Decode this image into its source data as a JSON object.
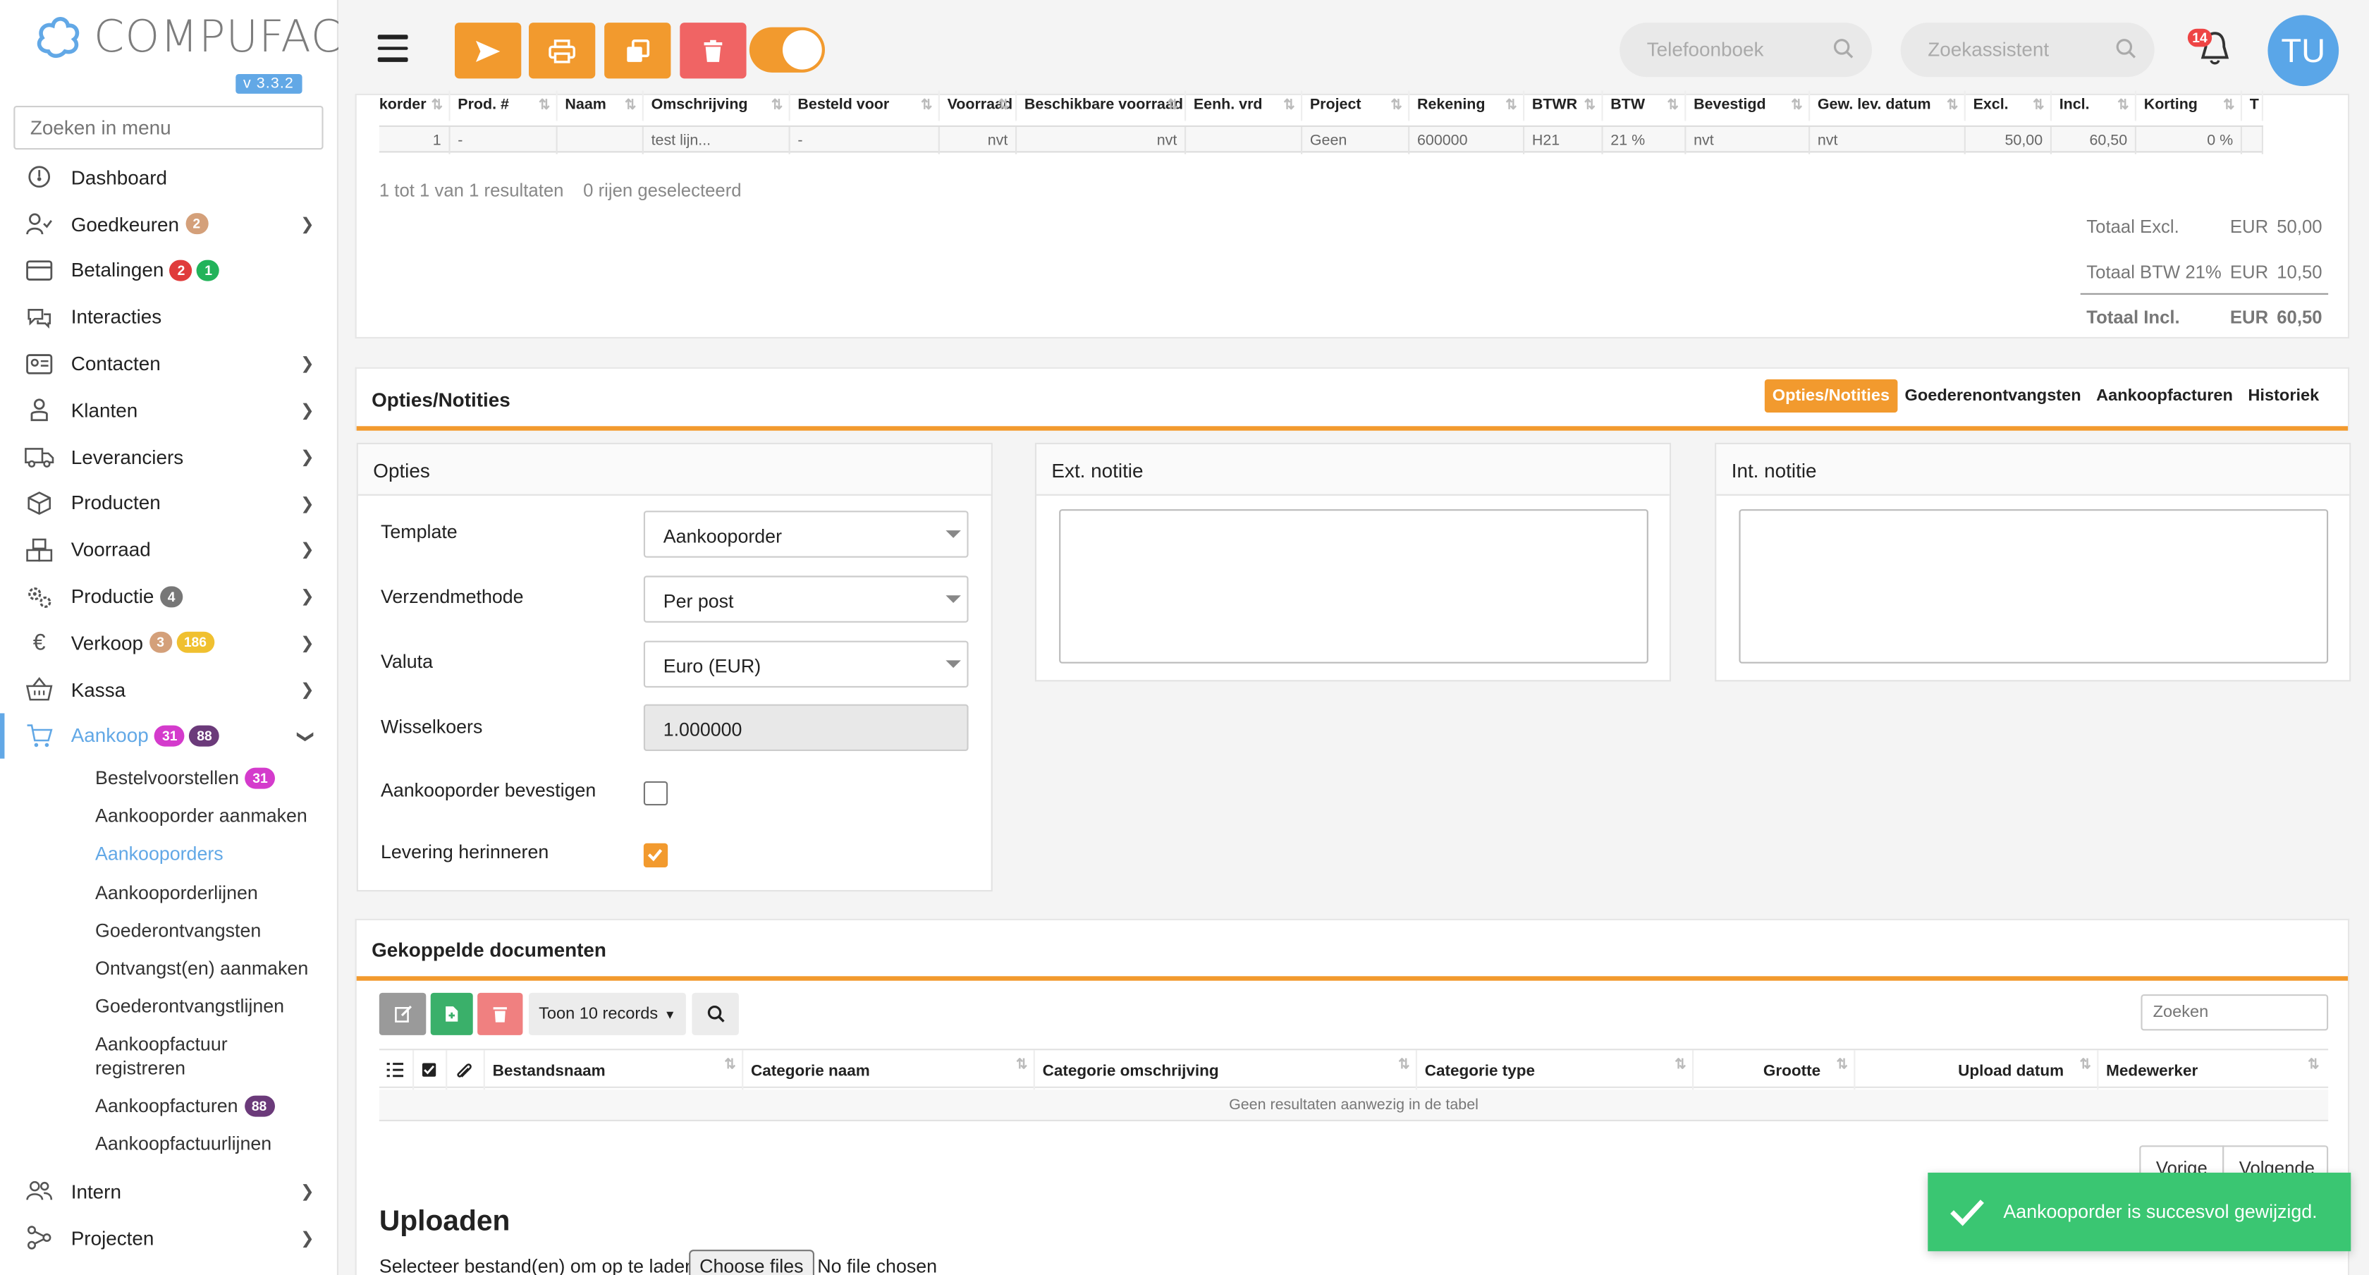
{
  "app": {
    "logo_text": "COMPUFACT",
    "version": "v 3.3.2"
  },
  "sidebar": {
    "search_placeholder": "Zoeken in menu",
    "items": [
      {
        "label": "Dashboard",
        "icon": "dashboard-icon"
      },
      {
        "label": "Goedkeuren",
        "icon": "user-check-icon",
        "badges": [
          "2"
        ]
      },
      {
        "label": "Betalingen",
        "icon": "credit-card-icon",
        "badges": [
          "2",
          "1"
        ]
      },
      {
        "label": "Interacties",
        "icon": "chat-icon"
      },
      {
        "label": "Contacten",
        "icon": "contact-card-icon"
      },
      {
        "label": "Klanten",
        "icon": "person-icon"
      },
      {
        "label": "Leveranciers",
        "icon": "truck-icon"
      },
      {
        "label": "Producten",
        "icon": "box-icon"
      },
      {
        "label": "Voorraad",
        "icon": "boxes-icon"
      },
      {
        "label": "Productie",
        "icon": "gears-icon",
        "badges": [
          "4"
        ]
      },
      {
        "label": "Verkoop",
        "icon": "euro-icon",
        "badges": [
          "3",
          "186"
        ]
      },
      {
        "label": "Kassa",
        "icon": "basket-icon"
      },
      {
        "label": "Aankoop",
        "icon": "cart-icon",
        "badges": [
          "31",
          "88"
        ]
      }
    ],
    "aankoop_sub": [
      {
        "label": "Bestelvoorstellen",
        "badge": "31"
      },
      {
        "label": "Aankooporder aanmaken"
      },
      {
        "label": "Aankooporders"
      },
      {
        "label": "Aankooporderlijnen"
      },
      {
        "label": "Goederontvangsten"
      },
      {
        "label": "Ontvangst(en) aanmaken"
      },
      {
        "label": "Goederontvangstlijnen"
      },
      {
        "label": "Aankoopfactuur registreren"
      },
      {
        "label": "Aankoopfacturen",
        "badge": "88"
      },
      {
        "label": "Aankoopfactuurlijnen"
      }
    ],
    "bottom_items": [
      {
        "label": "Intern",
        "icon": "people-icon"
      },
      {
        "label": "Projecten",
        "icon": "network-icon"
      }
    ]
  },
  "topbar": {
    "phonebook_placeholder": "Telefoonboek",
    "assistant_placeholder": "Zoekassistent",
    "notification_count": "14",
    "avatar_initials": "TU"
  },
  "lines_table": {
    "headers": [
      "korder",
      "Prod. #",
      "Naam",
      "Omschrijving",
      "Besteld voor",
      "Voorraad",
      "Beschikbare voorraad",
      "Eenh. vrd",
      "Project",
      "Rekening",
      "BTWR",
      "BTW",
      "Bevestigd",
      "Gew. lev. datum",
      "Excl.",
      "Incl.",
      "Korting",
      "T"
    ],
    "row": [
      "1",
      "-",
      "",
      "test lijn...",
      "-",
      "nvt",
      "nvt",
      "",
      "Geen",
      "600000",
      "H21",
      "21 %",
      "nvt",
      "nvt",
      "50,00",
      "60,50",
      "0 %",
      ""
    ],
    "result_info": "1 tot 1 van 1 resultaten",
    "selected_info": "0 rijen geselecteerd"
  },
  "totals": [
    {
      "label": "Totaal Excl.",
      "currency": "EUR",
      "value": "50,00"
    },
    {
      "label": "Totaal BTW 21%",
      "currency": "EUR",
      "value": "10,50"
    },
    {
      "label": "Totaal Incl.",
      "currency": "EUR",
      "value": "60,50"
    }
  ],
  "options_section": {
    "title": "Opties/Notities",
    "tabs": [
      "Opties/Notities",
      "Goederenontvangsten",
      "Aankoopfacturen",
      "Historiek"
    ],
    "opties_title": "Opties",
    "ext_note_title": "Ext. notitie",
    "int_note_title": "Int. notitie",
    "fields": {
      "template_label": "Template",
      "template_value": "Aankooporder",
      "verzend_label": "Verzendmethode",
      "verzend_value": "Per post",
      "valuta_label": "Valuta",
      "valuta_value": "Euro (EUR)",
      "wissel_label": "Wisselkoers",
      "wissel_value": "1.000000",
      "bevestigen_label": "Aankooporder bevestigen",
      "bevestigen_checked": false,
      "herinneren_label": "Levering herinneren",
      "herinneren_checked": true
    }
  },
  "documents": {
    "title": "Gekoppelde documenten",
    "show_records": "Toon 10 records",
    "search_placeholder": "Zoeken",
    "headers": [
      "Bestandsnaam",
      "Categorie naam",
      "Categorie omschrijving",
      "Categorie type",
      "Grootte",
      "Upload datum",
      "Medewerker"
    ],
    "empty_text": "Geen resultaten aanwezig in de tabel",
    "prev": "Vorige",
    "next": "Volgende"
  },
  "upload": {
    "title": "Uploaden",
    "label": "Selecteer bestand(en) om op te laden",
    "button": "Choose files",
    "status": "No file chosen"
  },
  "toast": {
    "message": "Aankooporder is succesvol gewijzigd."
  },
  "colors": {
    "accent": "#f29a2e",
    "primary": "#62a8e6",
    "danger": "#f06464",
    "success": "#3ac672"
  }
}
